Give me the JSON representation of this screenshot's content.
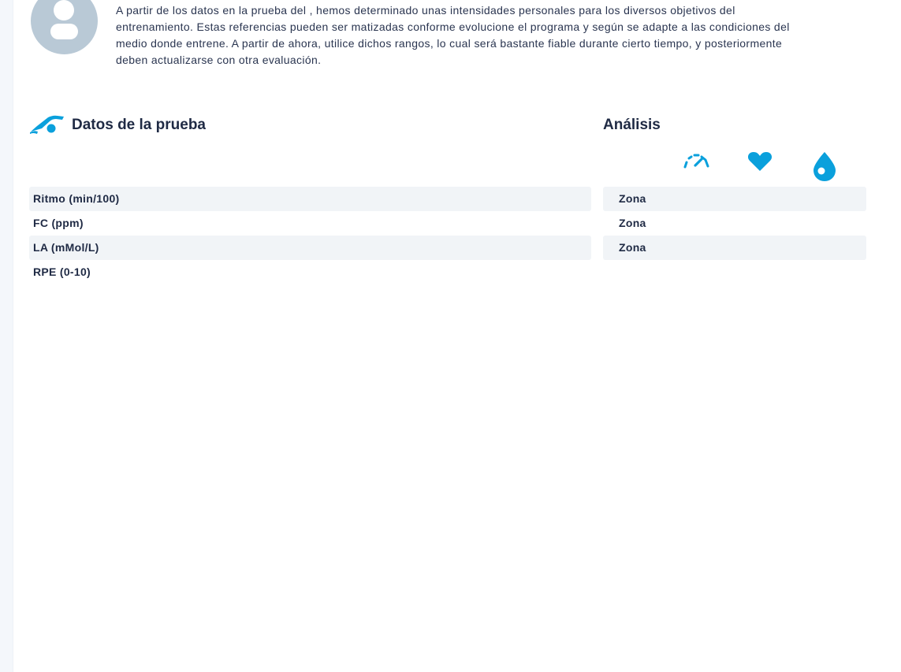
{
  "intro": {
    "text": "A partir de los datos en la prueba del , hemos determinado unas intensidades personales para los diversos objetivos del entrenamiento. Estas referencias pueden ser matizadas conforme evolucione el programa y según se adapte a las condiciones del medio donde entrene. A partir de ahora, utilice dichos rangos, lo cual será bastante fiable durante cierto tiempo, y posteriormente deben actualizarse con otra evaluación."
  },
  "test_data": {
    "title": "Datos de la prueba",
    "icon": "swimmer-icon",
    "rows": [
      {
        "label": "Ritmo (min/100)"
      },
      {
        "label": "FC (ppm)"
      },
      {
        "label": "LA (mMol/L)"
      },
      {
        "label": "RPE (0-10)"
      }
    ]
  },
  "analysis": {
    "title": "Análisis",
    "icons": [
      "speedometer-icon",
      "heart-icon",
      "drop-icon"
    ],
    "rows": [
      {
        "label": "Zona"
      },
      {
        "label": "Zona"
      },
      {
        "label": "Zona"
      }
    ]
  },
  "colors": {
    "accent": "#0aa0dc",
    "row_shade": "#f1f4f7",
    "avatar": "#b9c9d6",
    "text": "#1f2a44"
  }
}
